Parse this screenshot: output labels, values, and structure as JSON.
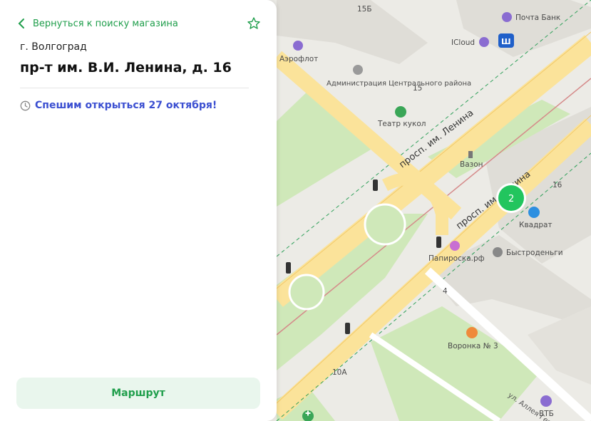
{
  "panel": {
    "back_label": "Вернуться к поиску магазина",
    "city": "г. Волгоград",
    "address": "пр-т им. В.И. Ленина, д. 16",
    "status": "Спешим открыться 27 октября!",
    "route_label": "Маршрут"
  },
  "map": {
    "streets": [
      "просп. им. Ленина",
      "просп. им. Ленина",
      "ул. Аллея Героев"
    ],
    "buildings": [
      "15Б",
      "15",
      "16",
      "4",
      "10А"
    ],
    "poi": {
      "pochta_bank": "Почта Банк",
      "icloud": "ICloud",
      "aeroflot": "Аэрофлот",
      "administration": "Администрация Центрального района",
      "teatr_kukol": "Театр кукол",
      "vazon": "Вазон",
      "kvadrat": "Квадрат",
      "papiroska": "Папироска.рф",
      "bystrodengi": "Быстроденьги",
      "voronka": "Воронка № 3",
      "vtb": "ВТБ"
    },
    "cluster_count": "2"
  },
  "colors": {
    "accent": "#1f9e4b",
    "status": "#3b4fd1",
    "road": "#fbe39a",
    "park": "#cfe8b9",
    "cluster": "#22c55e"
  }
}
